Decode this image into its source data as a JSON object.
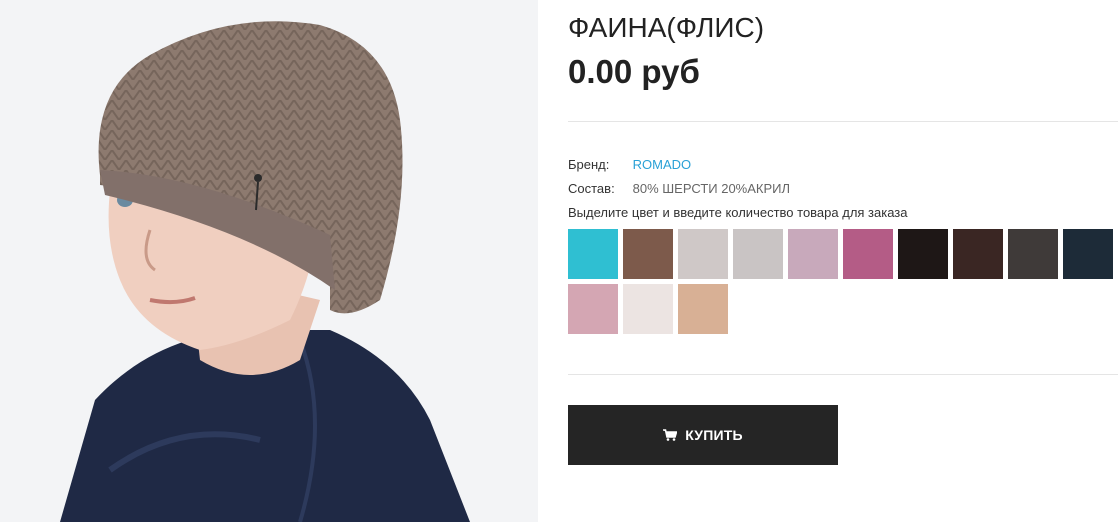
{
  "product": {
    "title": "ФАИНА(ФЛИС)",
    "price": "0.00 руб",
    "image_alt": "hat-photo"
  },
  "attributes": {
    "brand_label": "Бренд:",
    "brand_value": "ROMADO",
    "composition_label": "Состав:",
    "composition_value": "80% ШЕРСТИ 20%АКРИЛ"
  },
  "color_hint": "Выделите цвет и введите количество товара для заказа",
  "colors": [
    "#2fbfd2",
    "#7d5a4b",
    "#cfc8c7",
    "#c9c4c4",
    "#c8a9bb",
    "#b45c86",
    "#1e1716",
    "#3a2623",
    "#3f3a39",
    "#1d2b38",
    "#d4a6b3",
    "#ece4e2",
    "#d8b095"
  ],
  "buy": {
    "label": "КУПИТЬ",
    "icon": "cart-icon"
  }
}
